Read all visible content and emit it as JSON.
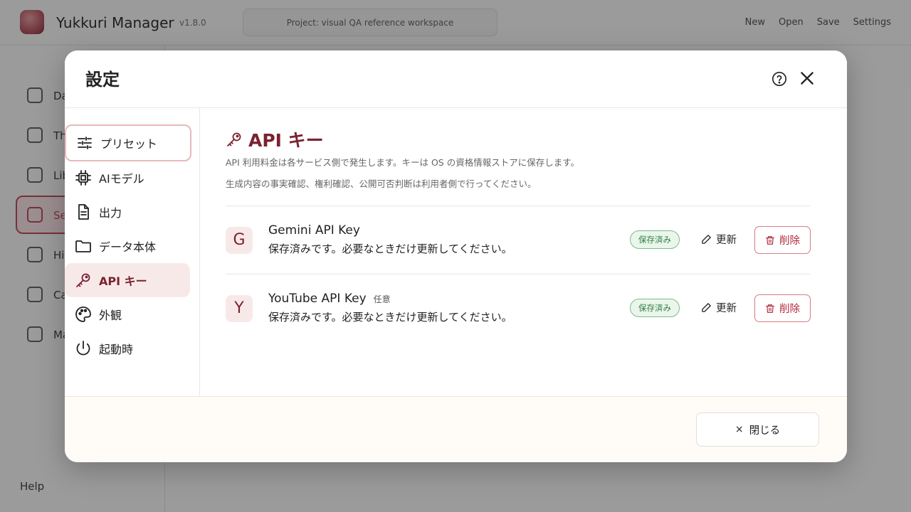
{
  "app": {
    "title": "Yukkuri Manager",
    "version": "v1.8.0",
    "project": "Project: visual QA reference workspace",
    "menu": [
      "New",
      "Open",
      "Save",
      "Settings"
    ],
    "sidebar_items": [
      "Da",
      "Th",
      "Lib",
      "Se",
      "Hi",
      "Ca",
      "Ma"
    ],
    "help": "Help"
  },
  "modal": {
    "title": "設定",
    "nav": [
      {
        "label": "プリセット",
        "icon": "sliders-icon"
      },
      {
        "label": "AIモデル",
        "icon": "chip-icon"
      },
      {
        "label": "出力",
        "icon": "document-icon"
      },
      {
        "label": "データ本体",
        "icon": "folder-icon"
      },
      {
        "label": "API キー",
        "icon": "key-icon"
      },
      {
        "label": "外観",
        "icon": "palette-icon"
      },
      {
        "label": "起動時",
        "icon": "power-icon"
      }
    ],
    "section": {
      "title": "API キー",
      "desc1": "API 利用料金は各サービス側で発生します。キーは OS の資格情報ストアに保存します。",
      "desc2": "生成内容の事実確認、権利確認、公開可否判断は利用者側で行ってください。"
    },
    "keys": [
      {
        "avatar": "G",
        "name": "Gemini API Key",
        "optional": "",
        "status": "保存済みです。必要なときだけ更新してください。",
        "badge": "保存済み",
        "update": "更新",
        "delete": "削除"
      },
      {
        "avatar": "Y",
        "name": "YouTube API Key",
        "optional": "任意",
        "status": "保存済みです。必要なときだけ更新してください。",
        "badge": "保存済み",
        "update": "更新",
        "delete": "削除"
      }
    ],
    "footer": {
      "close": "閉じる",
      "close_icon": "×"
    }
  },
  "colors": {
    "accent": "#7a2230",
    "saved_green": "#2e7d3f",
    "danger": "#b02a3a"
  }
}
